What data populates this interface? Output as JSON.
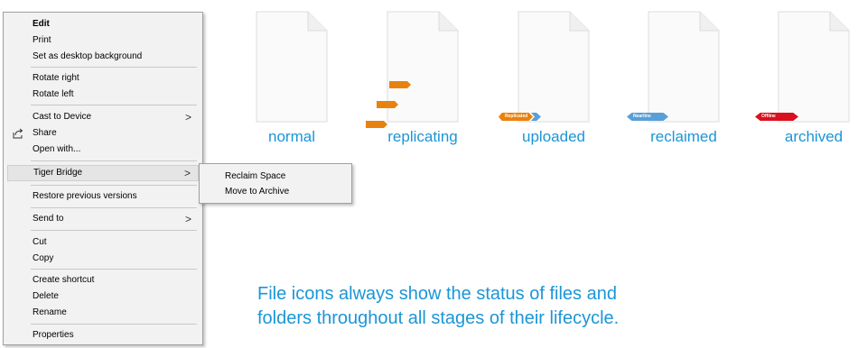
{
  "context_menu": {
    "items": [
      {
        "label": "Edit"
      },
      {
        "label": "Print"
      },
      {
        "label": "Set as desktop background"
      },
      {
        "label": "Rotate right"
      },
      {
        "label": "Rotate left"
      },
      {
        "label": "Cast to Device"
      },
      {
        "label": "Share"
      },
      {
        "label": "Open with..."
      },
      {
        "label": "Tiger Bridge"
      },
      {
        "label": "Restore previous versions"
      },
      {
        "label": "Send to"
      },
      {
        "label": "Cut"
      },
      {
        "label": "Copy"
      },
      {
        "label": "Create shortcut"
      },
      {
        "label": "Delete"
      },
      {
        "label": "Rename"
      },
      {
        "label": "Properties"
      }
    ],
    "submenu_chevron": ">",
    "share_icon": "share-icon"
  },
  "submenu": {
    "items": [
      {
        "label": "Reclaim Space"
      },
      {
        "label": "Move to Archive"
      }
    ]
  },
  "file_states": [
    {
      "label": "normal"
    },
    {
      "label": "replicating"
    },
    {
      "label": "uploaded",
      "tag": "Replicated",
      "tag_color": "#e8820e"
    },
    {
      "label": "reclaimed",
      "tag": "Nearline",
      "tag_color": "#5a9fd6"
    },
    {
      "label": "archived",
      "tag": "Offline",
      "tag_color": "#d9101d"
    }
  ],
  "colors": {
    "accent": "#1a96d8",
    "replicating_orange": "#e8820e"
  },
  "caption": {
    "line1": "File icons always show the status of files and",
    "line2": "folders throughout all stages of their lifecycle."
  }
}
